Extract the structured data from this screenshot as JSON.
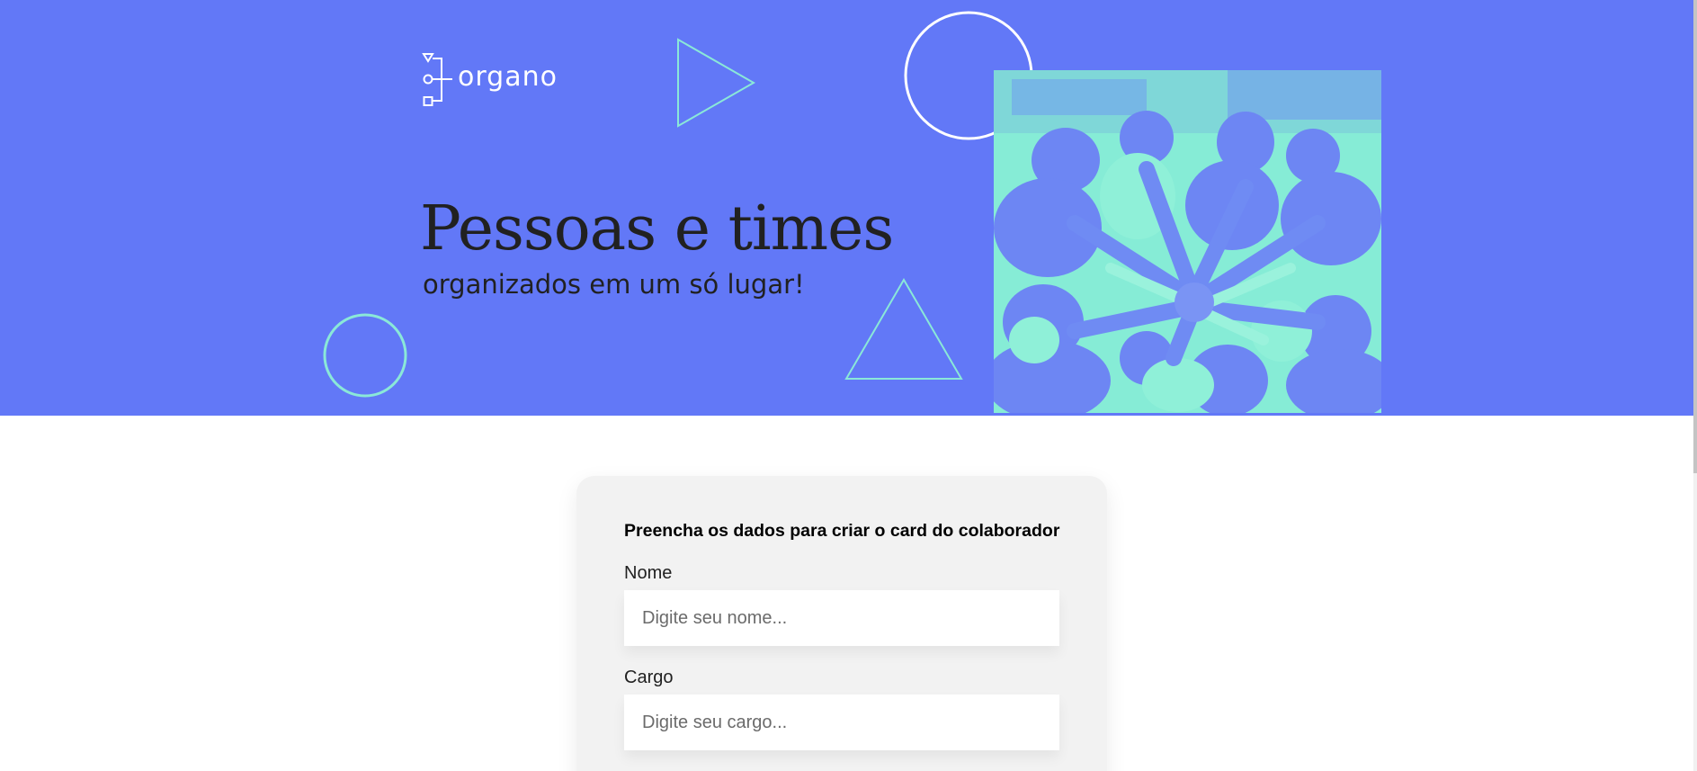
{
  "brand": {
    "logo_text": "organo"
  },
  "hero": {
    "title": "Pessoas e times",
    "subtitle": "organizados em um só lugar!",
    "image_icon": "team-photo"
  },
  "form": {
    "heading": "Preencha os dados para criar o card do colaborador",
    "fields": [
      {
        "label": "Nome",
        "placeholder": "Digite seu nome...",
        "value": ""
      },
      {
        "label": "Cargo",
        "placeholder": "Digite seu cargo...",
        "value": ""
      }
    ]
  },
  "colors": {
    "banner": "#6278f7",
    "accent_outline": "#8ae8d8",
    "photo_tint": "#8bf0d6",
    "card_bg": "#f2f2f2",
    "text_dark": "#212121"
  }
}
